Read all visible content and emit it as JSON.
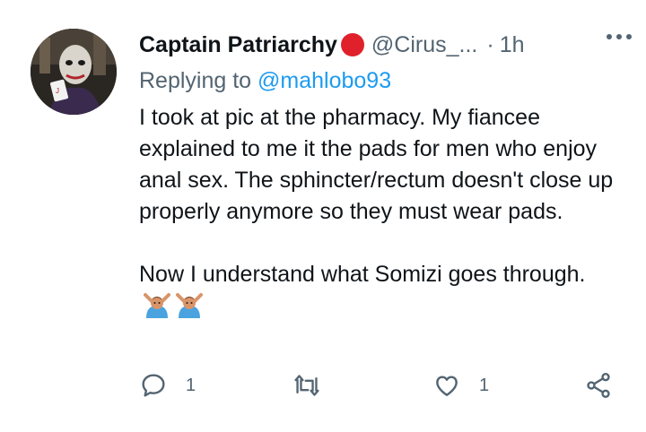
{
  "tweet": {
    "author_name": "Captain Patriarchy",
    "handle": "@Cirus_...",
    "separator": "·",
    "time": "1h",
    "replying_prefix": "Replying to",
    "replying_handle": "@mahlobo93",
    "paragraph_1": "I took at pic at the pharmacy. My fiancee explained to me it the pads for men who enjoy anal sex. The sphincter/rectum doesn't close up properly anymore so they must wear pads.",
    "paragraph_2": "Now I understand what Somizi goes through.",
    "emojis": [
      "person-gesturing-no",
      "person-gesturing-no"
    ]
  },
  "actions": {
    "reply_count": "1",
    "retweet_count": "",
    "like_count": "1"
  },
  "colors": {
    "text": "#0f1419",
    "secondary": "#536471",
    "link": "#1d9bf0",
    "status_dot": "#e0202a"
  }
}
